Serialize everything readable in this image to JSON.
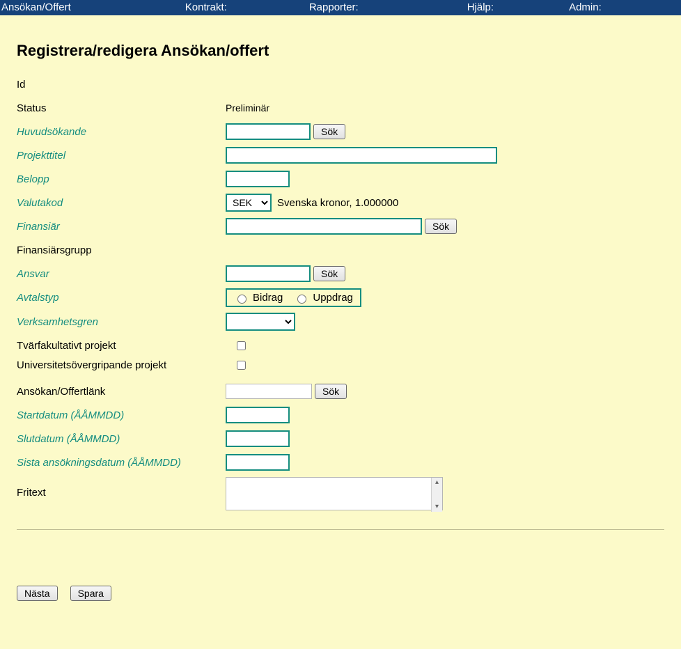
{
  "nav": {
    "items": [
      {
        "label": "Ansökan/Offert",
        "has_colon": false
      },
      {
        "label": "Kontrakt",
        "has_colon": true
      },
      {
        "label": "Rapporter",
        "has_colon": true
      },
      {
        "label": "Hjälp",
        "has_colon": true
      },
      {
        "label": "Admin",
        "has_colon": true
      }
    ]
  },
  "page": {
    "title": "Registrera/redigera Ansökan/offert",
    "labels": {
      "id": "Id",
      "status": "Status",
      "huvudsokande": "Huvudsökande",
      "projekttitel": "Projekttitel",
      "belopp": "Belopp",
      "valutakod": "Valutakod",
      "finansiar": "Finansiär",
      "finansiarsgrupp": "Finansiärsgrupp",
      "ansvar": "Ansvar",
      "avtalstyp": "Avtalstyp",
      "verksamhetsgren": "Verksamhetsgren",
      "tvarfakultativt": "Tvärfakultativt projekt",
      "universitetsovergrip": "Universitetsövergripande projekt",
      "ansokan_offertlank": "Ansökan/Offertlänk",
      "startdatum": "Startdatum (ÅÅMMDD)",
      "slutdatum": "Slutdatum (ÅÅMMDD)",
      "sista_ansokningsdatum": "Sista ansökningsdatum (ÅÅMMDD)",
      "fritext": "Fritext"
    },
    "status_value": "Preliminär",
    "sok_label": "Sök",
    "valutakod": {
      "selected": "SEK",
      "note": "Svenska kronor, 1.000000"
    },
    "avtalstyp": {
      "option1": "Bidrag",
      "option2": "Uppdrag"
    },
    "buttons": {
      "nasta": "Nästa",
      "spara": "Spara"
    }
  }
}
